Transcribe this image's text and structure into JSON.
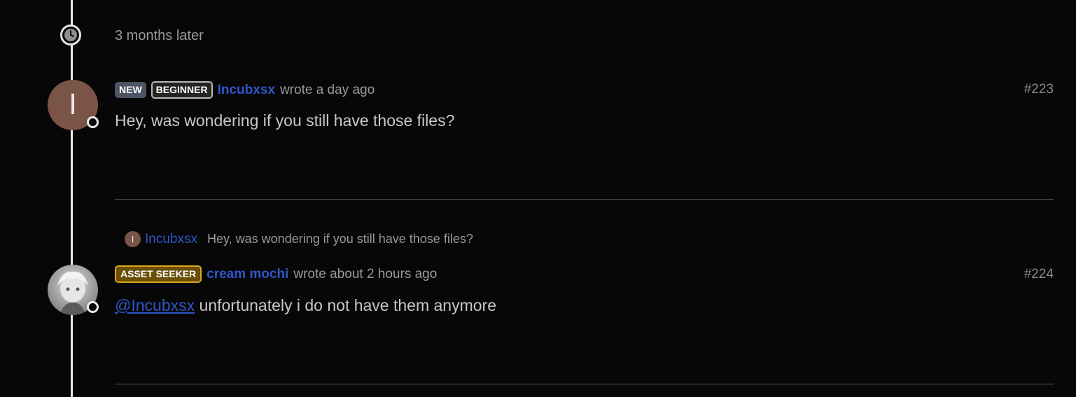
{
  "timeline": {
    "gap_label": "3 months later"
  },
  "posts": [
    {
      "avatar_letter": "I",
      "badges": [
        "NEW",
        "BEGINNER"
      ],
      "author": "Incubxsx",
      "meta": "wrote a day ago",
      "number": "#223",
      "body": "Hey, was wondering if you still have those files?"
    },
    {
      "reply_to": {
        "avatar_letter": "I",
        "author": "Incubxsx",
        "excerpt": "Hey, was wondering if you still have those files?"
      },
      "badges": [
        "ASSET SEEKER"
      ],
      "author": "cream mochi",
      "meta": "wrote about 2 hours ago",
      "number": "#224",
      "mention": "@Incubxsx",
      "body": "unfortunately i do not have them anymore"
    }
  ],
  "colors": {
    "background": "#070707",
    "link": "#2f56c9",
    "avatar_brown": "#7a5447",
    "seeker_badge": "#6a4e08"
  },
  "icons": {
    "timeline_gap": "clock-icon"
  }
}
